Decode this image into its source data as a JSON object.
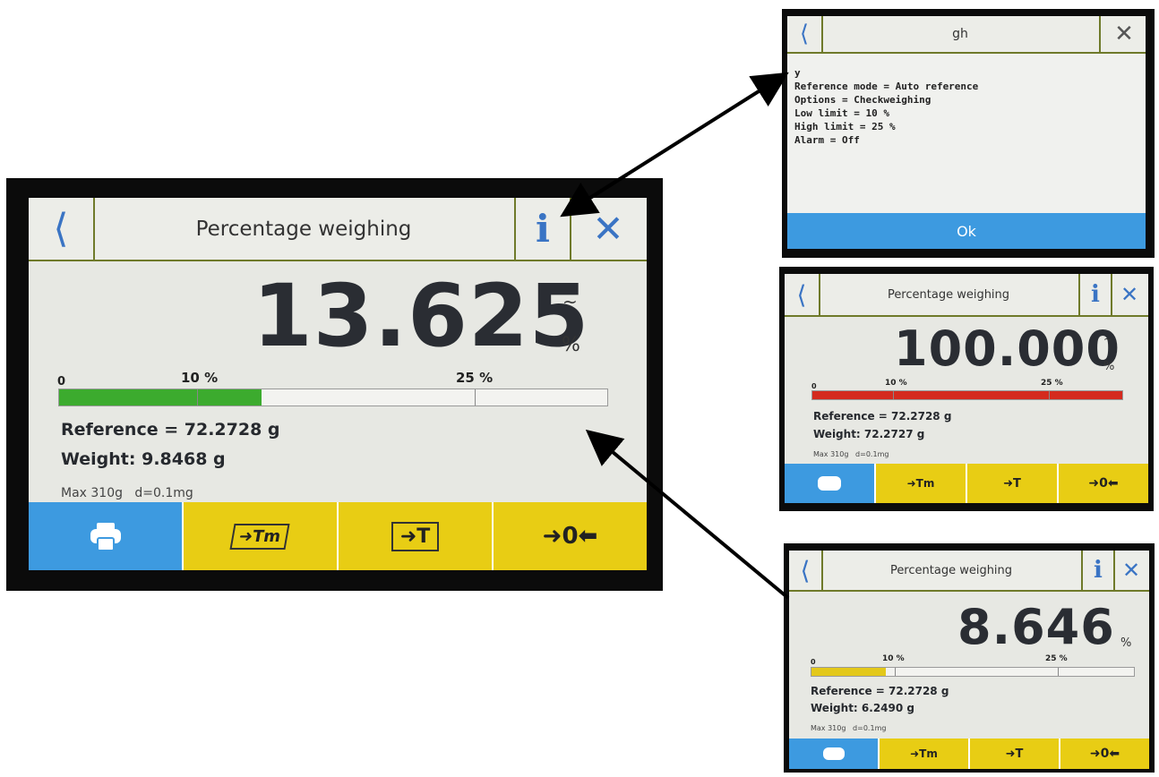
{
  "main": {
    "title": "Percentage weighing",
    "back_icon": "chevron-left-icon",
    "info_label": "i",
    "close_label": "✕",
    "value": "13.625",
    "tilde": "~",
    "unit": "%",
    "scale": {
      "zero": "0",
      "low": "10 %",
      "high": "25 %",
      "fill_fraction": 0.37,
      "fill_color": "#3cab2e"
    },
    "reference": "Reference = 72.2728 g",
    "weight": "Weight: 9.8468 g",
    "max_info": "Max 310g   d=0.1mg",
    "buttons": [
      {
        "icon": "printer-icon",
        "label": ""
      },
      {
        "icon": "tare-memory-icon",
        "label": "➜Tm"
      },
      {
        "icon": "tare-icon",
        "label": "➜T"
      },
      {
        "icon": "zero-icon",
        "label": "➜0⬅"
      }
    ]
  },
  "popup": {
    "title": "gh",
    "lines": "y\nReference mode = Auto reference\nOptions = Checkweighing\nLow limit = 10 %\nHigh limit = 25 %\nAlarm = Off",
    "ok_label": "Ok"
  },
  "over": {
    "title": "Percentage weighing",
    "value": "100.000",
    "tilde": "~",
    "unit": "%",
    "scale": {
      "zero": "0",
      "low": "10 %",
      "high": "25 %",
      "fill_fraction": 1.0,
      "fill_color": "#d42a1e"
    },
    "reference": "Reference = 72.2728 g",
    "weight": "Weight: 72.2727 g",
    "max_info": "Max 310g   d=0.1mg"
  },
  "under": {
    "title": "Percentage weighing",
    "value": "8.646",
    "unit": "%",
    "scale": {
      "zero": "0",
      "low": "10 %",
      "high": "25 %",
      "fill_fraction": 0.23,
      "fill_color": "#e3c81a"
    },
    "reference": "Reference = 72.2728 g",
    "weight": "Weight: 6.2490 g",
    "max_info": "Max 310g   d=0.1mg"
  }
}
